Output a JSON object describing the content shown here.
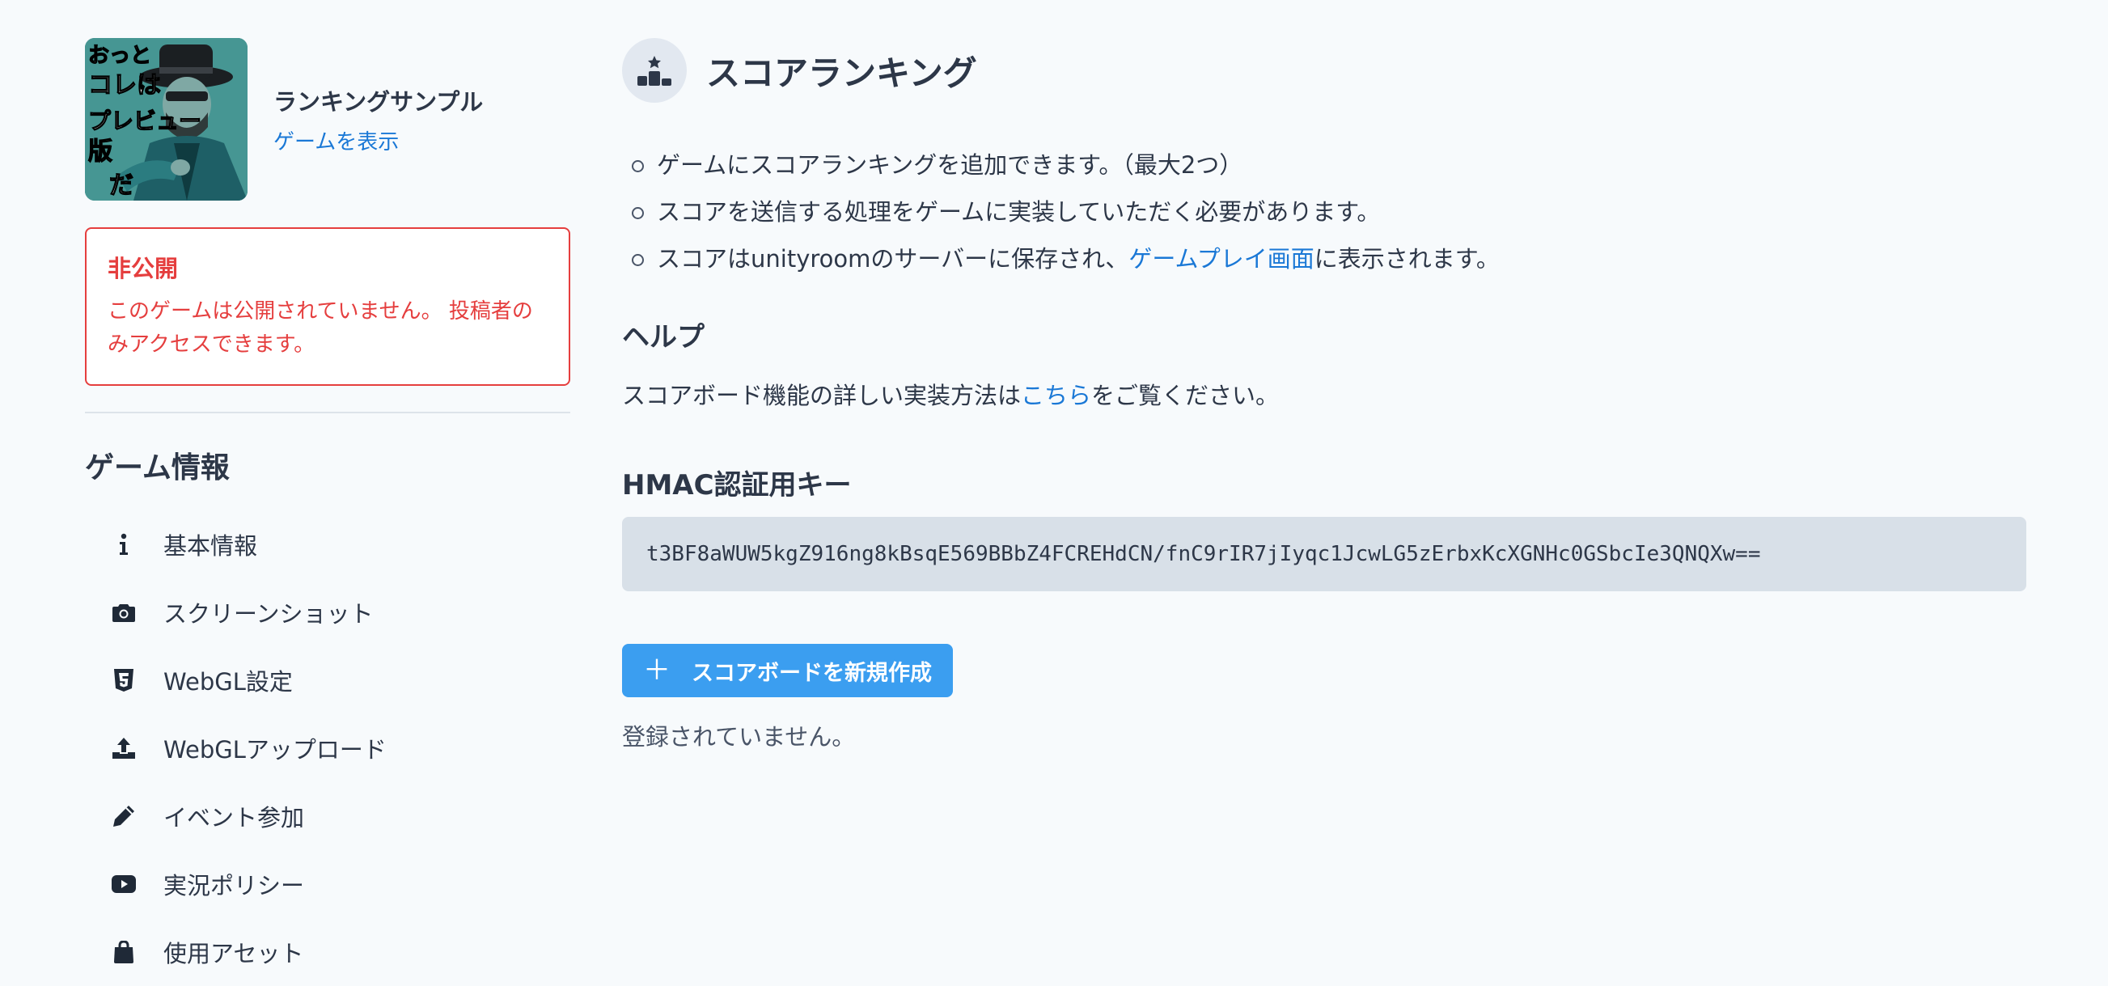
{
  "game": {
    "title": "ランキングサンプル",
    "view_link": "ゲームを表示",
    "thumbnail_lines": [
      "おっと",
      "コレは",
      "プレビュー",
      "版だ"
    ]
  },
  "status": {
    "title": "非公開",
    "message": "このゲームは公開されていません。 投稿者のみアクセスできます。"
  },
  "sidebar": {
    "section_title": "ゲーム情報",
    "items": [
      {
        "label": "基本情報",
        "icon": "info-icon"
      },
      {
        "label": "スクリーンショット",
        "icon": "camera-icon"
      },
      {
        "label": "WebGL設定",
        "icon": "html5-icon"
      },
      {
        "label": "WebGLアップロード",
        "icon": "upload-icon"
      },
      {
        "label": "イベント参加",
        "icon": "pencil-icon"
      },
      {
        "label": "実況ポリシー",
        "icon": "youtube-icon"
      },
      {
        "label": "使用アセット",
        "icon": "shopping-bag-icon"
      }
    ]
  },
  "main": {
    "title": "スコアランキング",
    "title_icon": "podium-icon",
    "bullets": [
      "ゲームにスコアランキングを追加できます。（最大2つ）",
      "スコアを送信する処理をゲームに実装していただく必要があります。"
    ],
    "bullet3": {
      "before": "スコアはunityroomのサーバーに保存され、",
      "link": "ゲームプレイ画面",
      "after": "に表示されます。"
    },
    "help": {
      "title": "ヘルプ",
      "before": "スコアボード機能の詳しい実装方法は",
      "link": "こちら",
      "after": "をご覧ください。"
    },
    "hmac": {
      "title": "HMAC認証用キー",
      "key": "t3BF8aWUW5kgZ916ng8kBsqE569BBbZ4FCREHdCN/fnC9rIR7jIyqc1JcwLG5zErbxKcXGNHc0GSbcIe3QNQXw=="
    },
    "create_button": "スコアボードを新規作成",
    "empty_text": "登録されていません。"
  },
  "colors": {
    "accent": "#3b9ef0",
    "link": "#1a78d6",
    "danger": "#e53e3e",
    "background": "#f7fafc"
  }
}
